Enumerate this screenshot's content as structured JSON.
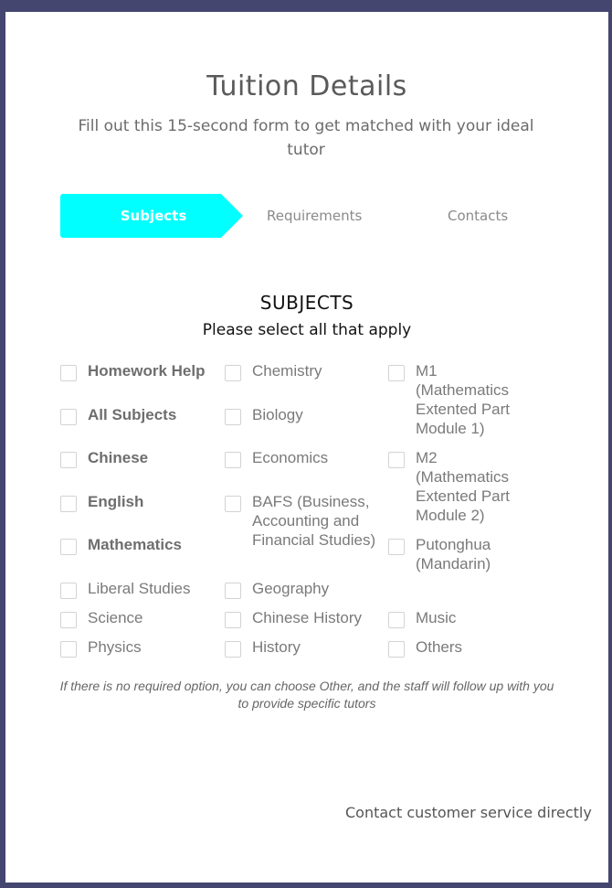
{
  "header": {
    "title": "Tuition Details",
    "subtitle": "Fill out this 15-second form to get matched with your ideal tutor"
  },
  "steps": [
    "Subjects",
    "Requirements",
    "Contacts"
  ],
  "active_step_color": "#00ffff",
  "section": {
    "title": "SUBJECTS",
    "subtitle": "Please select all that apply"
  },
  "subjects": {
    "col1": [
      "Homework Help",
      "All Subjects",
      "Chinese",
      "English",
      "Mathematics",
      "Liberal Studies",
      "Science",
      "Physics"
    ],
    "col2": [
      "Chemistry",
      "Biology",
      "Economics",
      "BAFS (Business, Accounting and Financial Studies)",
      "Geography",
      "Chinese History",
      "History"
    ],
    "col3": [
      "M1 (Mathematics Extented Part Module 1)",
      "M2 (Mathematics Extented Part Module 2)",
      "Putonghua (Mandarin)",
      "Music",
      "Others"
    ]
  },
  "note": "If there is no required option, you can choose Other, and the staff will follow up with you to provide specific tutors",
  "contact_link": "Contact customer service directly"
}
